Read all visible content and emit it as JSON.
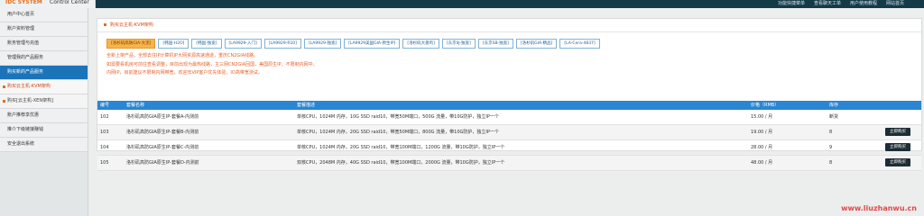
{
  "header": {
    "logo_brand": "IDC SYSTEM",
    "logo_title": "Control Center",
    "links": [
      "功能快捷菜单",
      "查看聊天工单",
      "用户使用教程",
      "网站首页"
    ]
  },
  "sidebar": {
    "items": [
      {
        "label": "用户中心首页",
        "type": "normal"
      },
      {
        "label": "账户资料管理",
        "type": "normal"
      },
      {
        "label": "账务管理与充值",
        "type": "normal"
      },
      {
        "label": "管理我的产品服务",
        "type": "normal"
      },
      {
        "label": "购买新的产品服务",
        "type": "active"
      },
      {
        "label": "购买云主机-KVM架构",
        "type": "sub"
      },
      {
        "label": "购买[云主机-XEN架构]",
        "type": "sub2"
      },
      {
        "label": "账户推荐享优惠",
        "type": "normal"
      },
      {
        "label": "推介下级链接赚钱",
        "type": "normal"
      },
      {
        "label": "安全退出系统",
        "type": "normal"
      }
    ]
  },
  "panel": {
    "title": "购买云主机-KVM架构",
    "tabs": [
      "[洛杉矶高防GIA-大流]",
      "[韩国-H2O]",
      "[韩国-独宽]",
      "[LA9929-入门]",
      "[LA9929-R10]",
      "[LA9929-独宽]",
      "[LA9929美国GIA-原生IP]",
      "[洛杉矶大盘鸡]",
      "[东京IIJ-独宽]",
      "[东京SB-独宽]",
      "[洛杉矶GIA-精品]",
      "[LA-Cera-4837]"
    ],
    "active_tab_index": 0,
    "notices": [
      "全新上架产品，全部去往IP计算机IP大网资源高速通道，重庆CN2GIA线路。",
      "如需要看机房可前往查看调整，目前出现为最热线路，主三网CN2GIA回国，美国原生IP，不限制内网中。",
      "内网IP，目前建议不限制内网带宽，欢迎年VIP客户优先体验，IO高带宽测试。"
    ]
  },
  "table": {
    "headers": [
      "编号",
      "套餐名称",
      "套餐描述",
      "价格（RMB）",
      "库存",
      ""
    ],
    "rows": [
      {
        "id": "102",
        "name": "洛杉矶高防GIA原生IP-套餐A-内测前",
        "desc": "单核CPU，1024M 内存，10G SSD raid10，带宽50M端口，500G 流量，带10G防护，独立IP一个",
        "price": "15.00 / 月",
        "stock": "断货",
        "button": ""
      },
      {
        "id": "103",
        "name": "洛杉矶高防GIA原生IP-套餐B-内测前",
        "desc": "单核CPU，1024M 内存，20G SSD raid10，带宽50M端口，800G 流量，带10G防护，独立IP一个",
        "price": "19.00 / 月",
        "stock": "8",
        "button": "立即购买"
      },
      {
        "id": "104",
        "name": "洛杉矶高防GIA原生IP-套餐C-内测前",
        "desc": "单核CPU，1024M 内存，20G SSD raid10，带宽100M端口，1200G 流量，带10G防护，独立IP一个",
        "price": "28.00 / 月",
        "stock": "9",
        "button": "立即购买"
      },
      {
        "id": "105",
        "name": "洛杉矶高防GIA原生IP-套餐D-内测前",
        "desc": "双核CPU，2048M 内存，40G SSD raid10，带宽100M端口，2000G 流量，带10G防护，独立IP一个",
        "price": "48.00 / 月",
        "stock": "8",
        "button": "立即购买"
      }
    ]
  },
  "watermark": "www.liuzhanwu.cn",
  "colors": {
    "topbar": "#143a48",
    "active": "#1b73b8",
    "accent": "#e36d1b",
    "table_head": "#2a86d2"
  }
}
